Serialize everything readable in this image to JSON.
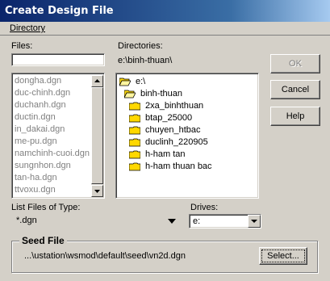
{
  "window": {
    "title": "Create Design File"
  },
  "menu": {
    "directory": "Directory"
  },
  "files": {
    "label": "Files:",
    "input_value": "",
    "items": [
      "dongha.dgn",
      "duc-chinh.dgn",
      "duchanh.dgn",
      "ductin.dgn",
      "in_dakai.dgn",
      "me-pu.dgn",
      "namchinh-cuoi.dgn",
      "sungnhon.dgn",
      "tan-ha.dgn",
      "ttvoxu.dgn"
    ]
  },
  "directories": {
    "label": "Directories:",
    "current_path": "e:\\binh-thuan\\",
    "items": [
      "e:\\",
      "binh-thuan",
      "2xa_binhthuan",
      "btap_25000",
      "chuyen_htbac",
      "duclinh_220905",
      "h-ham tan",
      "h-ham thuan bac"
    ]
  },
  "buttons": {
    "ok": "OK",
    "cancel": "Cancel",
    "help": "Help",
    "select": "Select..."
  },
  "file_type": {
    "label": "List Files of Type:",
    "value": "*.dgn"
  },
  "drives": {
    "label": "Drives:",
    "value": "e:"
  },
  "seed": {
    "label": "Seed File",
    "path": "...\\ustation\\wsmod\\default\\seed\\vn2d.dgn"
  },
  "colors": {
    "title_start": "#0a246a",
    "title_end": "#a6caf0",
    "face": "#d4d0c8",
    "folder": "#ffd800"
  }
}
